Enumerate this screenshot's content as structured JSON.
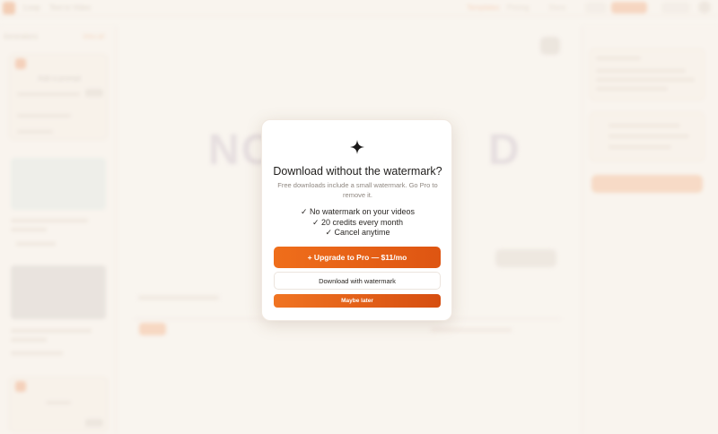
{
  "background": {
    "app_name": "Loop",
    "breadcrumb": "Text to Video",
    "top_links": [
      "Templates",
      "Pricing",
      "Docs"
    ],
    "left_panel": {
      "title": "Generations",
      "link": "View all",
      "card_title": "Add a prompt"
    },
    "center_placeholder": "NO",
    "center_placeholder_end": "D"
  },
  "modal": {
    "icon": "sparkle-icon",
    "title": "Download without the watermark?",
    "subtitle": "Free downloads include a small watermark. Go Pro to remove it.",
    "benefits": [
      "✓ No watermark on your videos",
      "✓ 20 credits every month",
      "✓ Cancel anytime"
    ],
    "upgrade_label": "+ Upgrade to Pro — $11/mo",
    "download_label": "Download with watermark",
    "later_label": "Maybe later"
  },
  "colors": {
    "accent": "#ef6e1b",
    "accent_dark": "#d64e10",
    "modal_bg": "#ffffff"
  }
}
